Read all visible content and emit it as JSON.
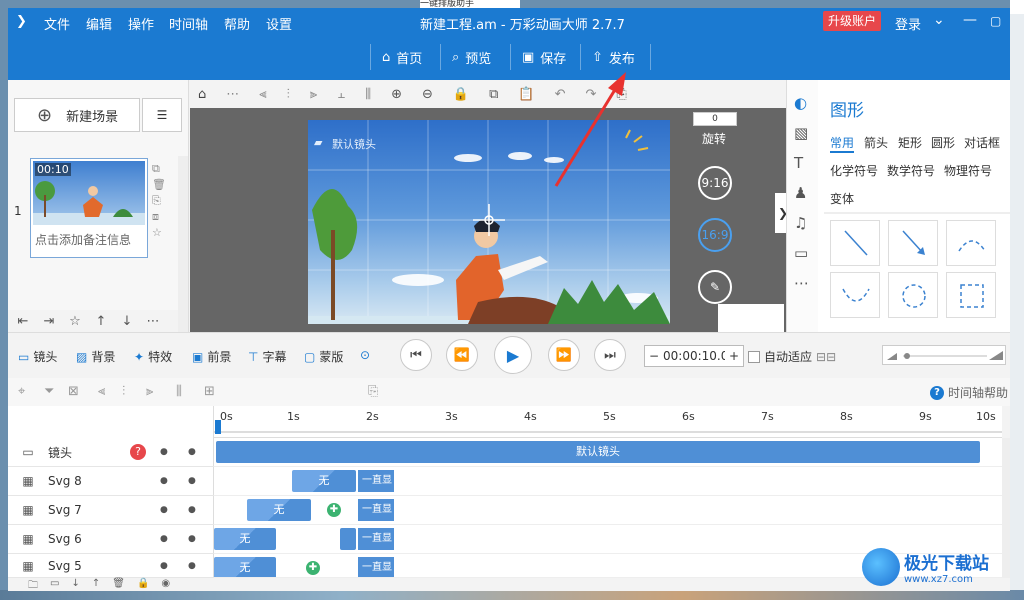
{
  "background": {
    "top_snippet": "一键排版助手"
  },
  "titlebar": {
    "title": "新建工程.am - 万彩动画大师 2.7.7",
    "menus": [
      "文件",
      "编辑",
      "操作",
      "时间轴",
      "帮助",
      "设置"
    ],
    "upgrade_label": "升级账户",
    "login_label": "登录",
    "buttons": {
      "home": "首页",
      "preview": "预览",
      "save": "保存",
      "publish": "发布"
    },
    "accent": "#1b7ad1",
    "upgrade_color": "#e7474b"
  },
  "left_panel": {
    "new_scene": "新建场景",
    "scene_number": "1",
    "scene_time": "00:10",
    "scene_note": "点击添加备注信息"
  },
  "canvas": {
    "camera_label": "默认镜头",
    "rotation_value": "0",
    "rotation_label": "旋转",
    "ratio_portrait": "9:16",
    "ratio_landscape": "16:9"
  },
  "right_panel": {
    "title": "图形",
    "tabs_row1": [
      "常用",
      "箭头",
      "矩形",
      "圆形",
      "对话框"
    ],
    "tabs_row2": [
      "化学符号",
      "数学符号",
      "物理符号"
    ],
    "tabs_row3": [
      "变体"
    ],
    "active_tab": "常用"
  },
  "transport": {
    "items": [
      "镜头",
      "背景",
      "特效",
      "前景",
      "字幕",
      "蒙版"
    ],
    "time": "00:00:10.0",
    "auto_fit": "自动适应"
  },
  "timeline": {
    "help": "时间轴帮助",
    "ruler": [
      "0s",
      "1s",
      "2s",
      "3s",
      "4s",
      "5s",
      "6s",
      "7s",
      "8s",
      "9s",
      "10s"
    ],
    "tracks": [
      {
        "name": "镜头",
        "icon": "camera-icon"
      },
      {
        "name": "Svg 8",
        "icon": "svg-icon"
      },
      {
        "name": "Svg 7",
        "icon": "svg-icon"
      },
      {
        "name": "Svg 6",
        "icon": "svg-icon"
      },
      {
        "name": "Svg 5",
        "icon": "svg-icon"
      }
    ],
    "camera_clip": "默认镜头",
    "clip_none": "无",
    "clip_keep": "一直显"
  },
  "watermark": {
    "name": "极光下载站",
    "url": "www.xz7.com"
  }
}
